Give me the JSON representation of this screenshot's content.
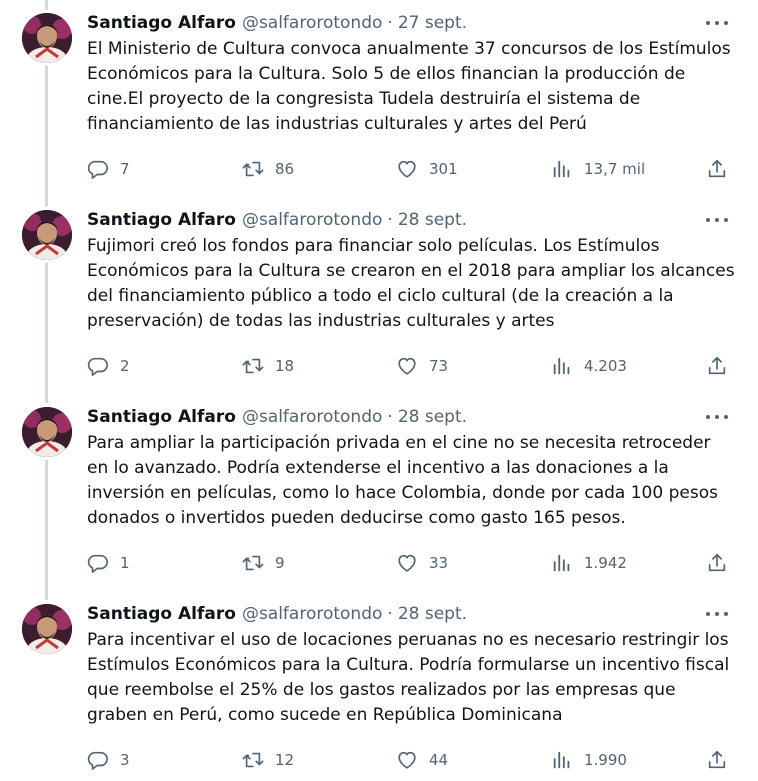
{
  "tweets": [
    {
      "name": "Santiago Alfaro",
      "handle": "@salfarorotondo",
      "separator": "·",
      "date": "27 sept.",
      "text": "El Ministerio de Cultura convoca anualmente 37 concursos de los Estímulos Económicos para la Cultura. Solo 5 de ellos financian la producción de cine.El proyecto de la congresista Tudela destruiría el sistema de financiamiento de las industrias culturales y artes del Perú",
      "replies": "7",
      "retweets": "86",
      "likes": "301",
      "views": "13,7 mil"
    },
    {
      "name": "Santiago Alfaro",
      "handle": "@salfarorotondo",
      "separator": "·",
      "date": "28 sept.",
      "text": "Fujimori creó los fondos para financiar solo películas. Los Estímulos Económicos para la Cultura se crearon en el 2018 para ampliar los alcances del financiamiento público a todo el ciclo cultural (de la creación a la preservación) de todas las industrias culturales y artes",
      "replies": "2",
      "retweets": "18",
      "likes": "73",
      "views": "4.203"
    },
    {
      "name": "Santiago Alfaro",
      "handle": "@salfarorotondo",
      "separator": "·",
      "date": "28 sept.",
      "text": "Para ampliar la participación privada en el cine no se necesita retroceder en lo avanzado. Podría extenderse el incentivo a las donaciones a la inversión en películas, como lo hace Colombia, donde por cada 100 pesos donados o invertidos pueden deducirse como gasto 165 pesos.",
      "replies": "1",
      "retweets": "9",
      "likes": "33",
      "views": "1.942"
    },
    {
      "name": "Santiago Alfaro",
      "handle": "@salfarorotondo",
      "separator": "·",
      "date": "28 sept.",
      "text": "Para incentivar el uso de locaciones peruanas no es necesario restringir los Estímulos Económicos para la Cultura. Podría formularse un incentivo fiscal que reembolse el 25% de los gastos realizados por las empresas que graben en Perú, como sucede en República Dominicana",
      "replies": "3",
      "retweets": "12",
      "likes": "44",
      "views": "1.990"
    }
  ],
  "icons": {
    "reply": "reply-icon",
    "retweet": "retweet-icon",
    "like": "like-icon",
    "views": "views-icon",
    "share": "share-icon",
    "more": "more-icon"
  },
  "colors": {
    "text": "#0f1419",
    "secondary": "#536471",
    "thread_line": "#cfd9de"
  }
}
